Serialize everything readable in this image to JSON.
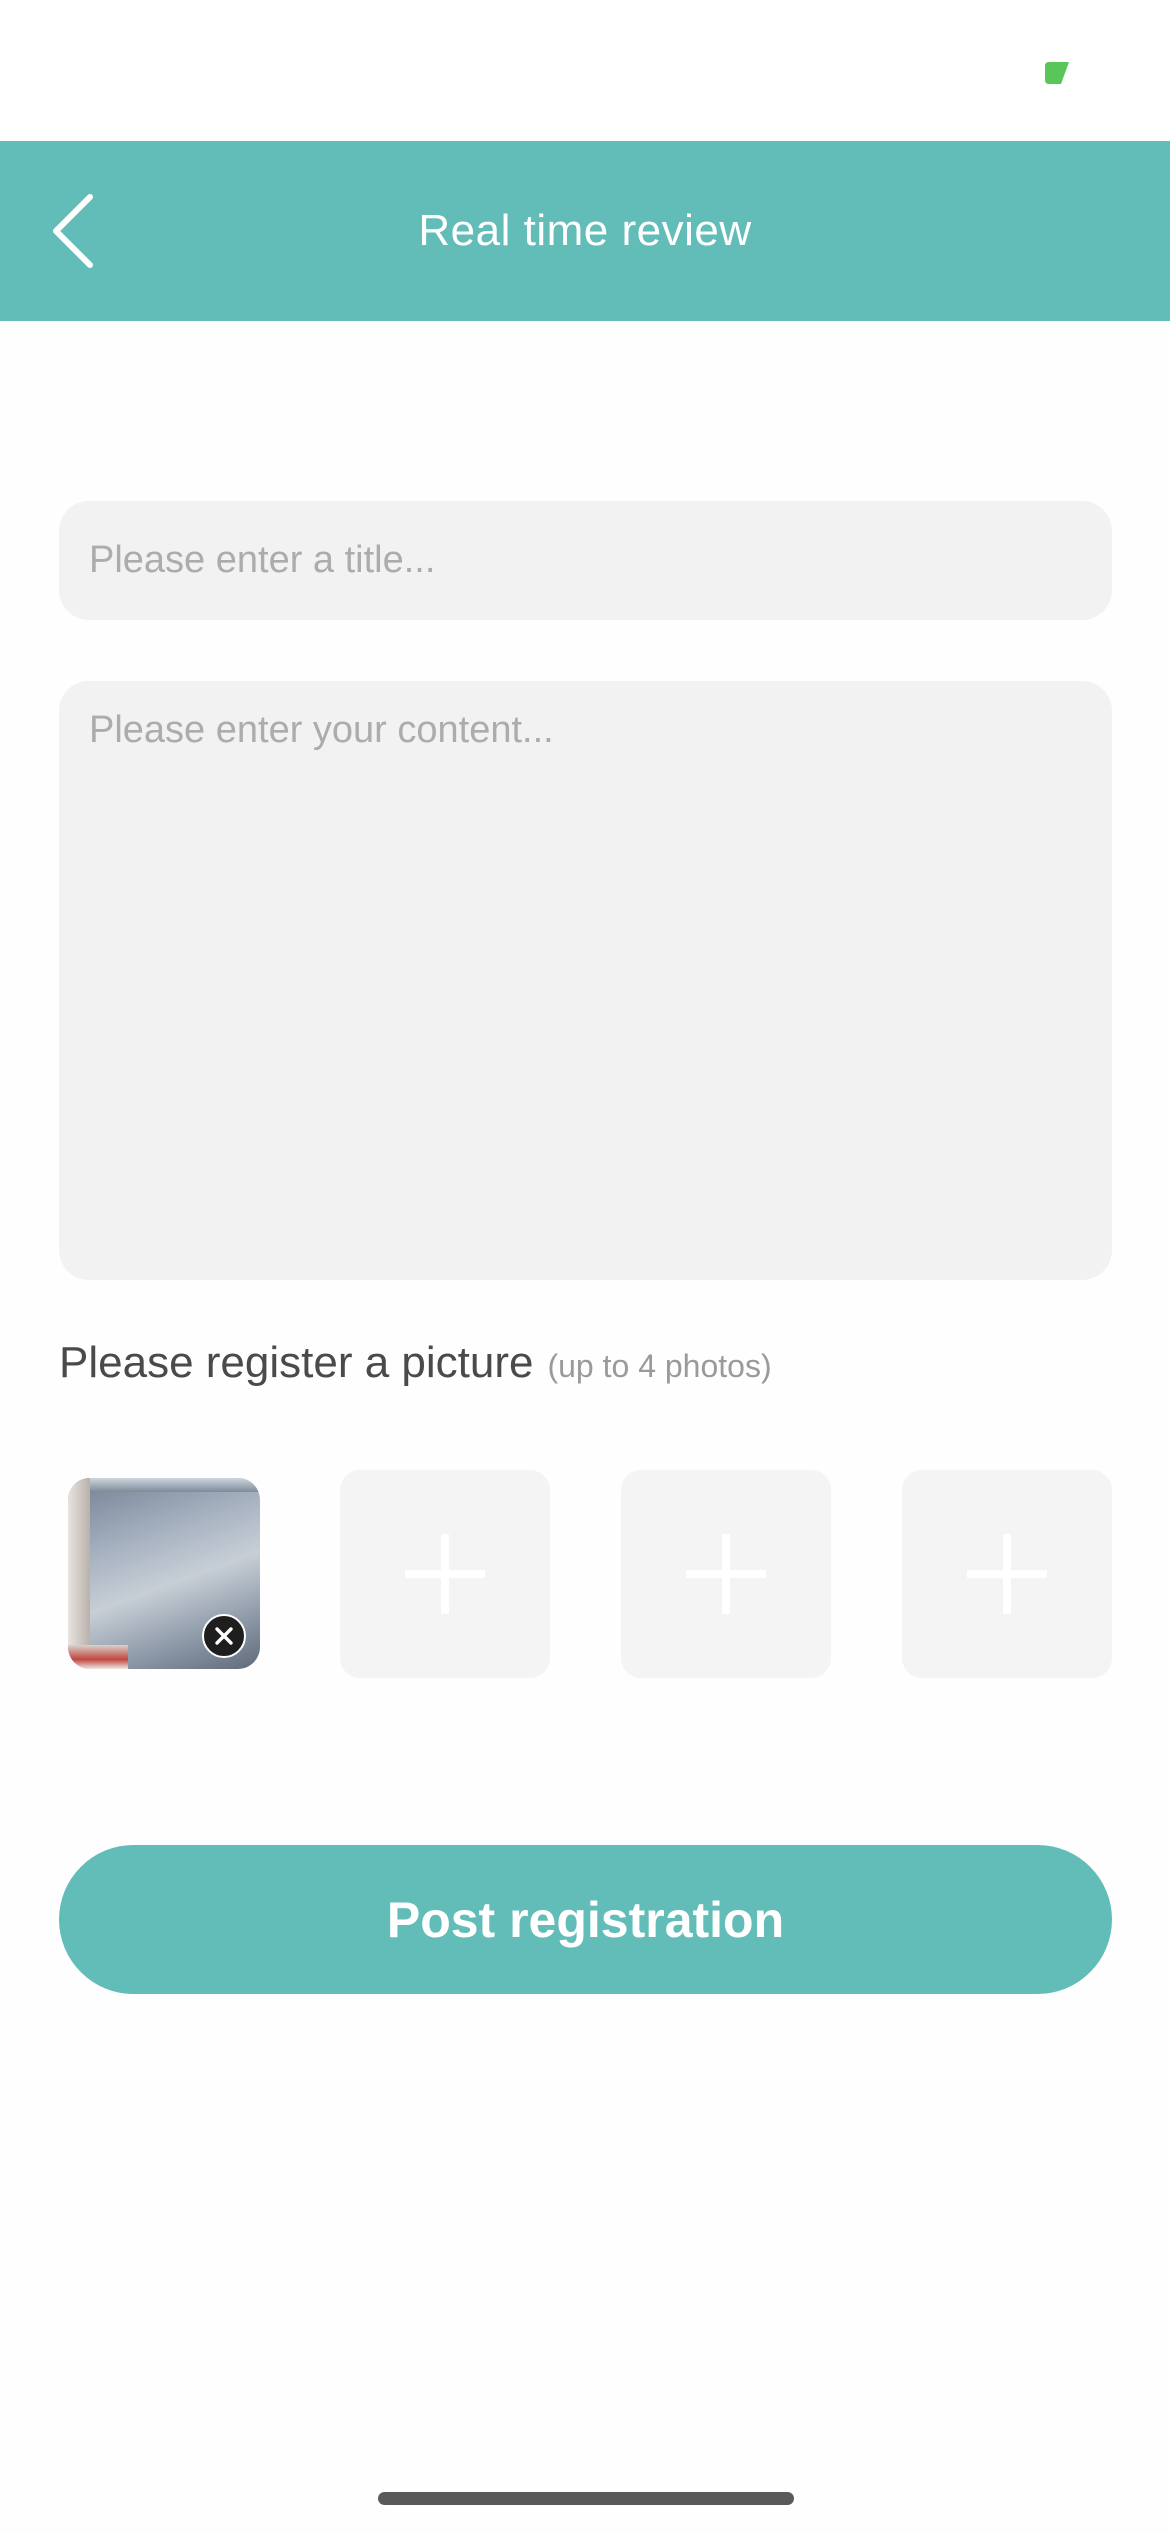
{
  "header": {
    "title": "Real time review"
  },
  "form": {
    "title_placeholder": "Please enter a title...",
    "title_value": "",
    "content_placeholder": "Please enter your content...",
    "content_value": ""
  },
  "pictures": {
    "label": "Please register a picture",
    "note": "(up to 4 photos)",
    "max_photos": 4,
    "uploaded_count": 1
  },
  "submit": {
    "label": "Post registration"
  },
  "colors": {
    "accent": "#62bdb8",
    "input_background": "#f2f2f2",
    "slot_background": "#f4f4f5",
    "status_indicator": "#5ac65a"
  },
  "icons": {
    "back": "chevron-left-icon",
    "add": "plus-icon",
    "remove": "close-icon"
  }
}
